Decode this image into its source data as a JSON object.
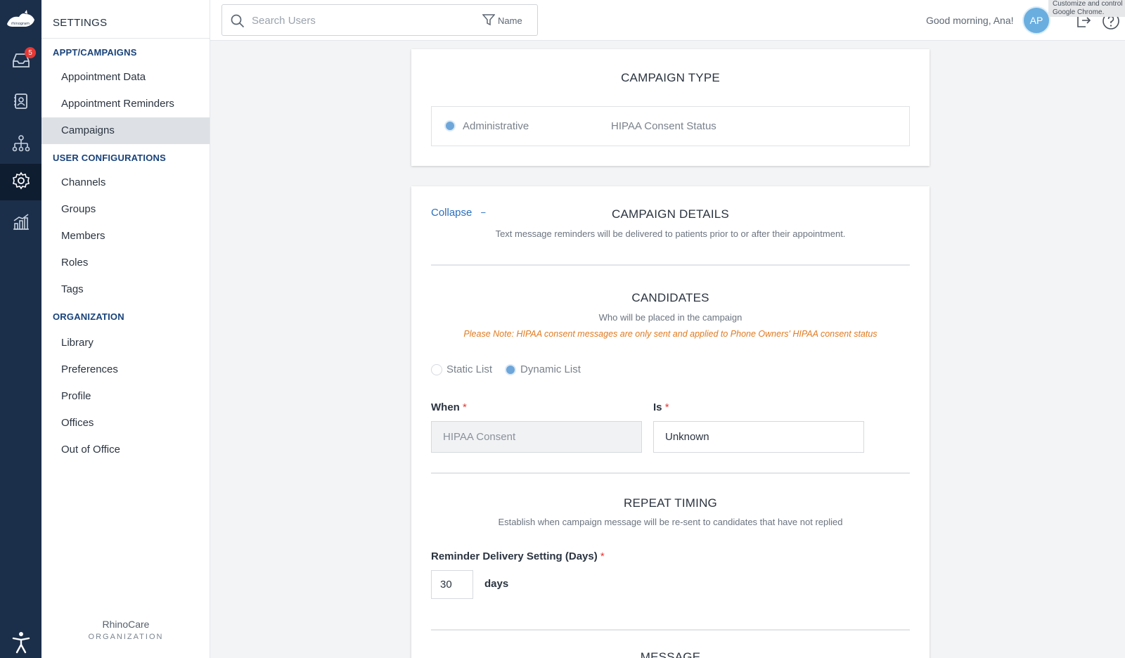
{
  "colors": {
    "rail": "#1c2f4a",
    "accent": "#2a6fbf",
    "note": "#e07a1f",
    "badge": "#e53935"
  },
  "rail": {
    "logo_text": "rhinogram",
    "inbox_badge": "5",
    "icons": [
      "inbox-icon",
      "contacts-icon",
      "org-chart-icon",
      "settings-icon",
      "analytics-icon",
      "accessibility-icon"
    ]
  },
  "sidebar": {
    "title": "SETTINGS",
    "sections": [
      {
        "label": "APPT/CAMPAIGNS",
        "items": [
          "Appointment Data",
          "Appointment Reminders",
          "Campaigns"
        ]
      },
      {
        "label": "USER CONFIGURATIONS",
        "items": [
          "Channels",
          "Groups",
          "Members",
          "Roles",
          "Tags"
        ]
      },
      {
        "label": "ORGANIZATION",
        "items": [
          "Library",
          "Preferences",
          "Profile",
          "Offices",
          "Out of Office"
        ]
      }
    ],
    "active_item": "Campaigns",
    "org_name": "RhinoCare",
    "org_type": "ORGANIZATION"
  },
  "topbar": {
    "search_placeholder": "Search Users",
    "filter_label": "Name",
    "greeting": "Good morning, Ana!",
    "avatar_initials": "AP",
    "tooltip": "Customize and control Google Chrome. Update is available."
  },
  "campaign_type": {
    "heading": "CAMPAIGN TYPE",
    "option_selected": "Administrative",
    "option_other": "HIPAA Consent Status"
  },
  "campaign_details": {
    "collapse_label": "Collapse",
    "collapse_symbol": "−",
    "heading": "CAMPAIGN DETAILS",
    "subtitle": "Text message reminders will be delivered to patients prior to or after their appointment."
  },
  "candidates": {
    "heading": "CANDIDATES",
    "subtitle": "Who will be placed in the campaign",
    "note": "Please Note: HIPAA consent messages are only sent and applied to Phone Owners' HIPAA consent status",
    "static_label": "Static List",
    "dynamic_label": "Dynamic List",
    "when_label": "When",
    "when_value": "HIPAA Consent",
    "is_label": "Is",
    "is_value": "Unknown",
    "required_mark": "*"
  },
  "repeat_timing": {
    "heading": "REPEAT TIMING",
    "subtitle": "Establish when campaign message will be re-sent to candidates that have not replied",
    "delivery_label": "Reminder Delivery Setting (Days)",
    "days_value": "30",
    "days_unit": "days"
  },
  "message": {
    "heading": "MESSAGE"
  }
}
